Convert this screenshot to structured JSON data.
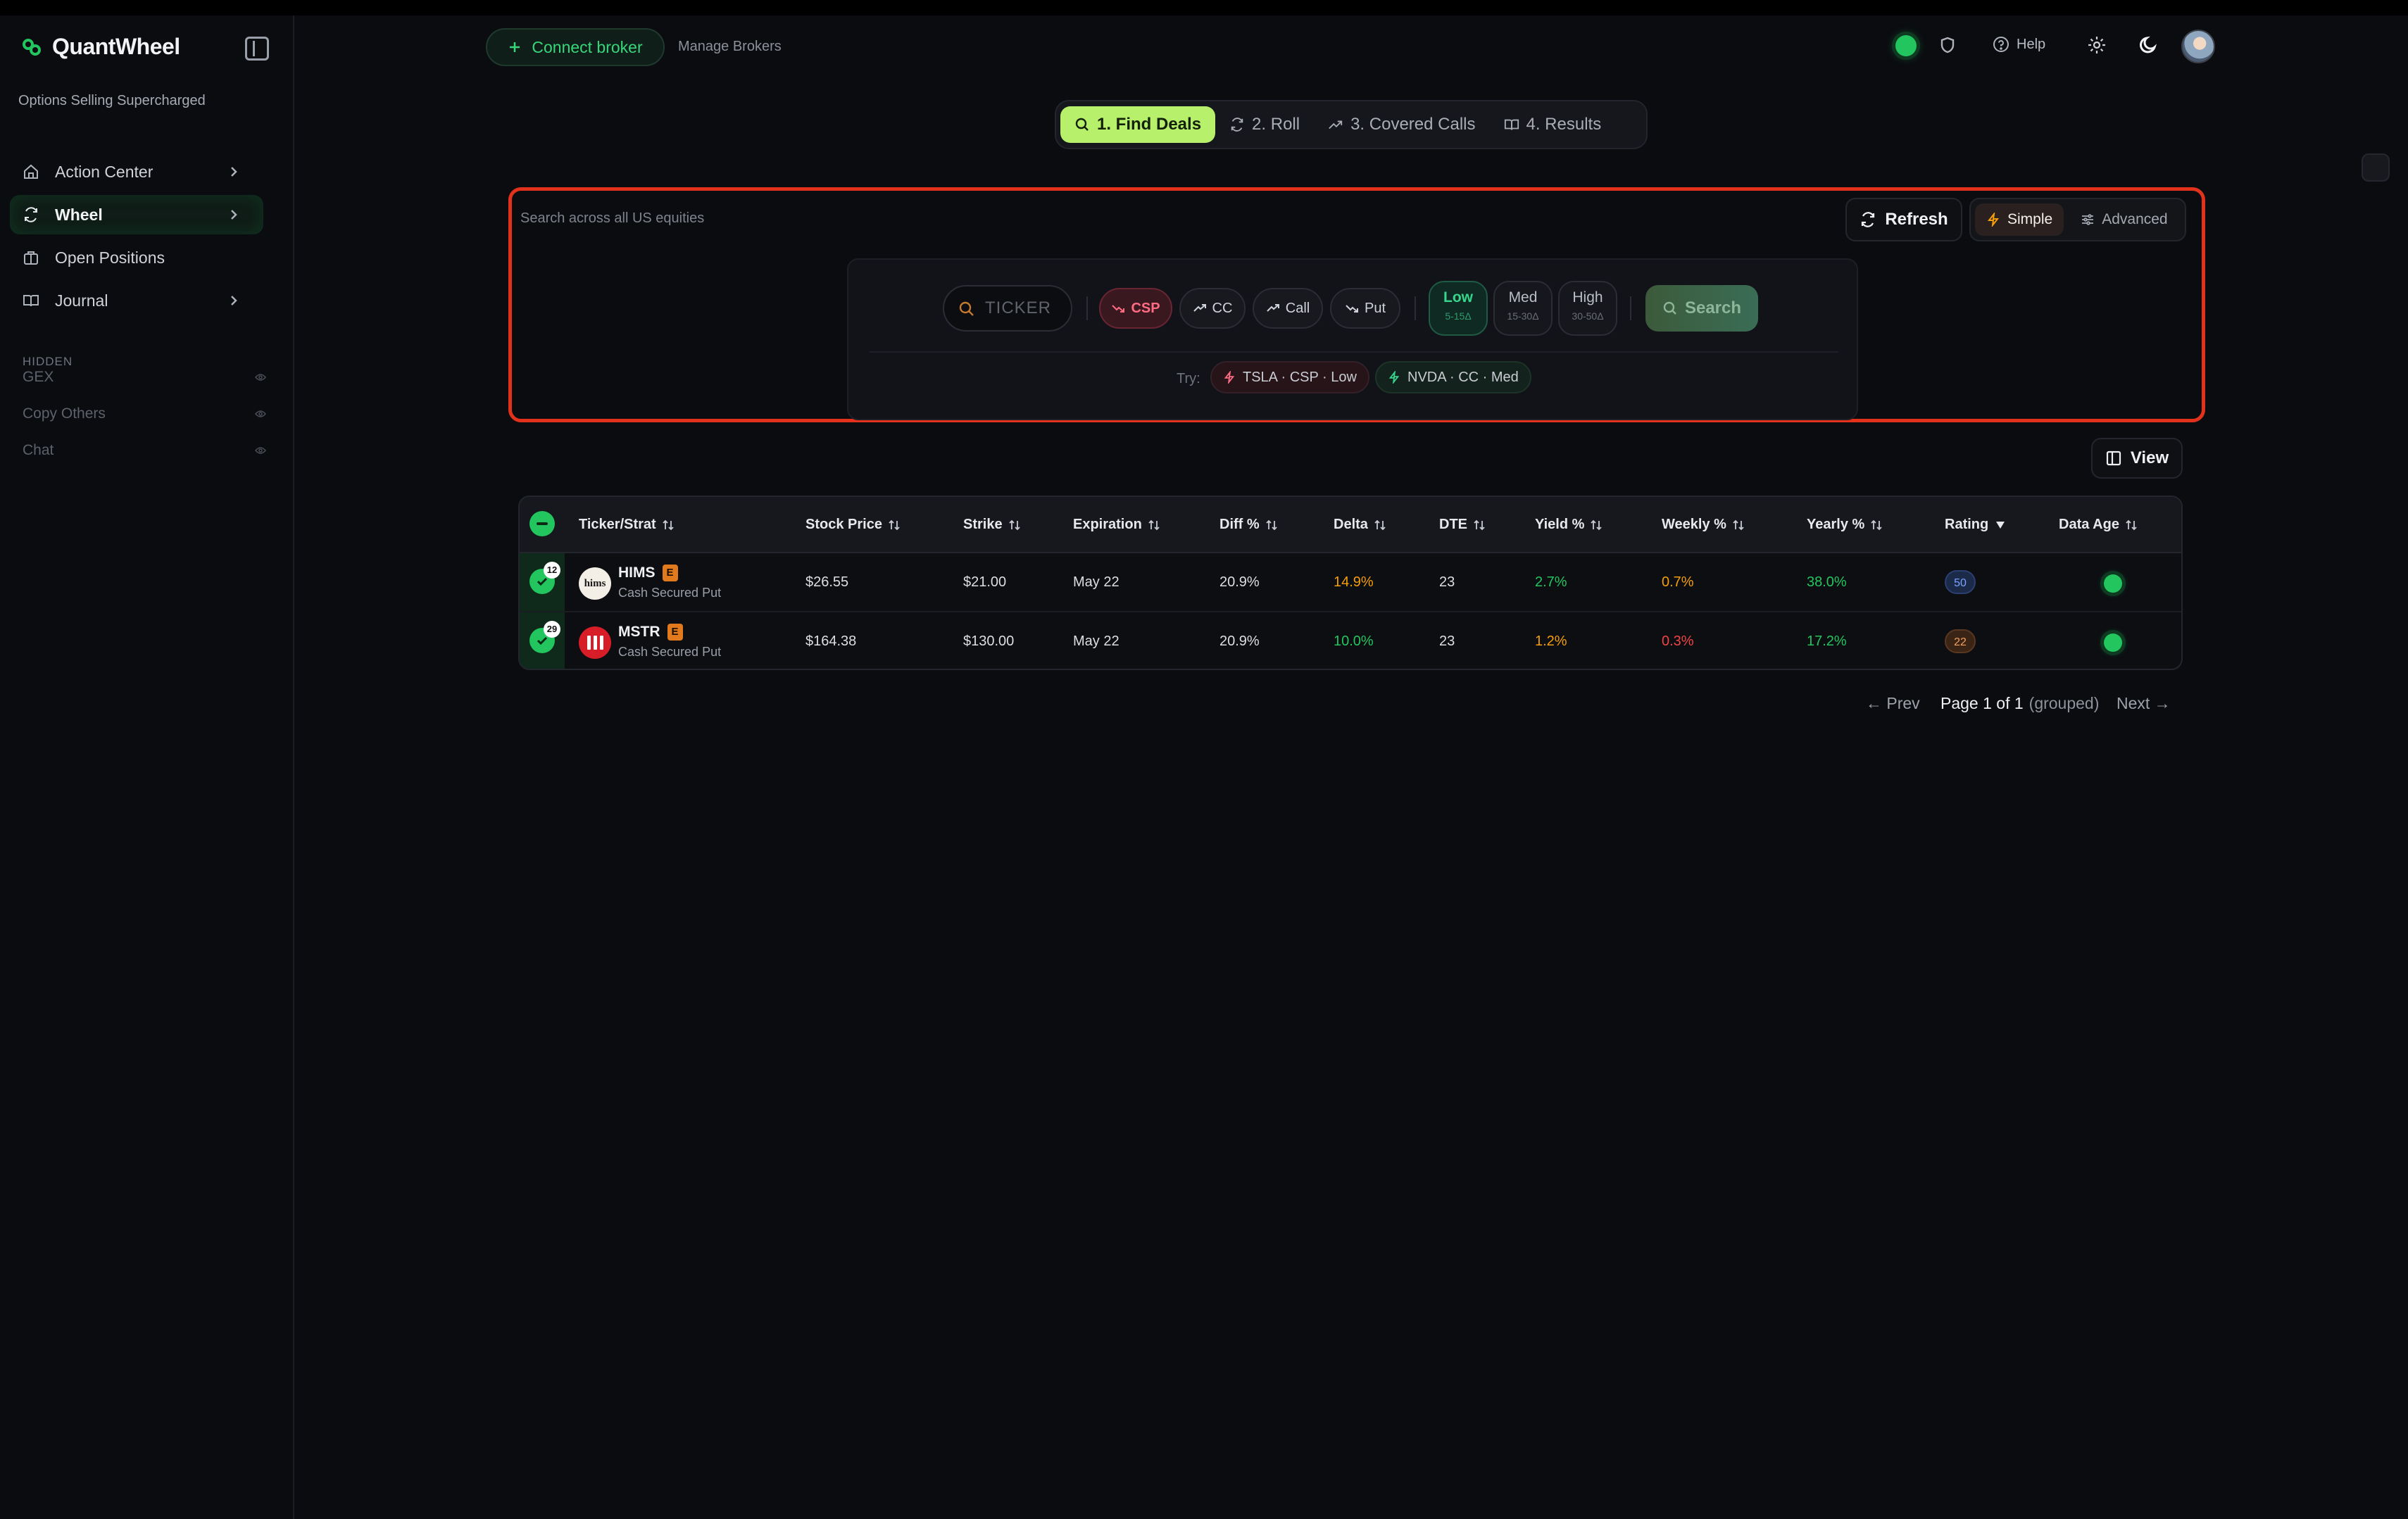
{
  "brand": {
    "name": "QuantWheel",
    "tagline": "Options Selling Supercharged"
  },
  "sidebar": {
    "items": [
      {
        "label": "Action Center",
        "icon": "home-icon",
        "chevron": true
      },
      {
        "label": "Wheel",
        "icon": "refresh-cycle-icon",
        "chevron": true,
        "active": true
      },
      {
        "label": "Open Positions",
        "icon": "briefcase-icon",
        "chevron": false
      },
      {
        "label": "Journal",
        "icon": "book-open-icon",
        "chevron": true
      }
    ],
    "hidden_label": "HIDDEN",
    "hidden_items": [
      {
        "label": "GEX"
      },
      {
        "label": "Copy Others"
      },
      {
        "label": "Chat"
      }
    ]
  },
  "header": {
    "connect_label": "Connect broker",
    "manage_label": "Manage Brokers",
    "help_label": "Help"
  },
  "steps": [
    {
      "label": "1. Find Deals",
      "active": true
    },
    {
      "label": "2. Roll"
    },
    {
      "label": "3. Covered Calls"
    },
    {
      "label": "4. Results"
    }
  ],
  "search": {
    "hint": "Search across all US equities",
    "refresh_label": "Refresh",
    "modes": [
      "Simple",
      "Advanced"
    ],
    "active_mode": "Simple",
    "ticker_placeholder": "TICKER",
    "strategies": [
      "CSP",
      "CC",
      "Call",
      "Put"
    ],
    "active_strategy": "CSP",
    "risk": [
      {
        "label": "Low",
        "sub": "5-15Δ",
        "active": true
      },
      {
        "label": "Med",
        "sub": "15-30Δ"
      },
      {
        "label": "High",
        "sub": "30-50Δ"
      }
    ],
    "search_label": "Search",
    "try_label": "Try:",
    "try_chips": [
      "TSLA · CSP · Low",
      "NVDA · CC · Med"
    ]
  },
  "view_label": "View",
  "table": {
    "columns": [
      "Ticker/Strat",
      "Stock Price",
      "Strike",
      "Expiration",
      "Diff %",
      "Delta",
      "DTE",
      "Yield %",
      "Weekly %",
      "Yearly %",
      "Rating",
      "Data Age"
    ],
    "rows": [
      {
        "badge": "12",
        "ticker": "HIMS",
        "earn": "E",
        "strategy": "Cash Secured Put",
        "logo_text": "hims",
        "price": "$26.55",
        "strike": "$21.00",
        "expiration": "May 22",
        "diff": "20.9%",
        "delta": "14.9%",
        "dte": "23",
        "yield": "2.7%",
        "weekly": "0.7%",
        "yearly": "38.0%",
        "rating": "50"
      },
      {
        "badge": "29",
        "ticker": "MSTR",
        "earn": "E",
        "strategy": "Cash Secured Put",
        "logo_text": "",
        "price": "$164.38",
        "strike": "$130.00",
        "expiration": "May 22",
        "diff": "20.9%",
        "delta": "10.0%",
        "dte": "23",
        "yield": "1.2%",
        "weekly": "0.3%",
        "yearly": "17.2%",
        "rating": "22"
      }
    ]
  },
  "pagination": {
    "prev_label": "← Prev",
    "page_label": "Page 1 of 1",
    "grouped_label": "(grouped)",
    "next_label": "Next →"
  },
  "colors": {
    "accent_green": "#22c55e",
    "step_active": "#b7f06b",
    "search_border": "#e2321b",
    "csp_red": "#ff6b82"
  }
}
